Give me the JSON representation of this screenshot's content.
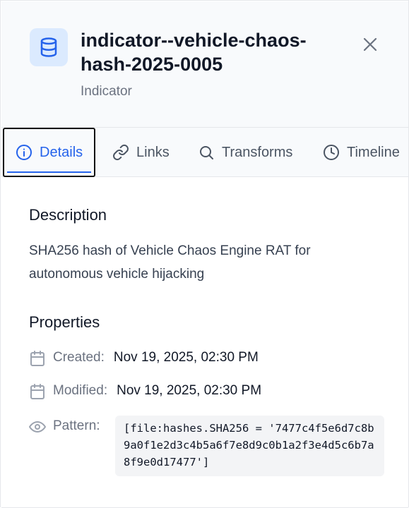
{
  "header": {
    "title": "indicator--vehicle-chaos-hash-2025-0005",
    "subtitle": "Indicator",
    "entity_icon": "database-icon",
    "close_icon": "close-icon"
  },
  "tabs": [
    {
      "label": "Details",
      "icon": "info-icon",
      "active": true
    },
    {
      "label": "Links",
      "icon": "link-icon",
      "active": false
    },
    {
      "label": "Transforms",
      "icon": "search-icon",
      "active": false
    },
    {
      "label": "Timeline",
      "icon": "clock-icon",
      "active": false
    }
  ],
  "description": {
    "heading": "Description",
    "text": "SHA256 hash of Vehicle Chaos Engine RAT for autonomous vehicle hijacking"
  },
  "properties": {
    "heading": "Properties",
    "created": {
      "label": "Created:",
      "value": "Nov 19, 2025, 02:30 PM",
      "icon": "calendar-icon"
    },
    "modified": {
      "label": "Modified:",
      "value": "Nov 19, 2025, 02:30 PM",
      "icon": "calendar-icon"
    },
    "pattern": {
      "label": "Pattern:",
      "value": "[file:hashes.SHA256 = '7477c4f5e6d7c8b9a0f1e2d3c4b5a6f7e8d9c0b1a2f3e4d5c6b7a8f9e0d17477']",
      "icon": "eye-icon"
    }
  },
  "colors": {
    "accent": "#2563eb",
    "header_bg": "#f8fafc",
    "icon_bg": "#dbeafe",
    "muted": "#6b7280"
  }
}
